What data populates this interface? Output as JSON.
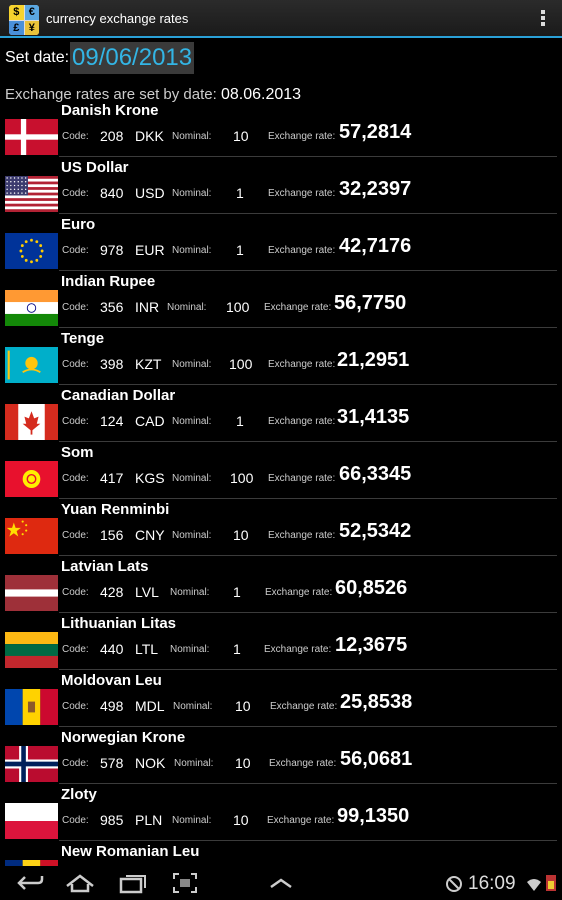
{
  "app": {
    "title": "currency exchange rates",
    "icon_letters": [
      "$",
      "€",
      "£",
      "¥"
    ]
  },
  "date_row": {
    "label": "Set date:",
    "value": "09/06/2013"
  },
  "rates_info": {
    "text": "Exchange rates are set by date:",
    "date": "08.06.2013"
  },
  "labels": {
    "code": "Code:",
    "nominal": "Nominal:",
    "exchange_rate": "Exchange rate:"
  },
  "currencies": [
    {
      "name": "Danish Krone",
      "num": "208",
      "iso": "DKK",
      "nominal": "10",
      "rate": "57,2814",
      "flag": "denmark-flag"
    },
    {
      "name": "US Dollar",
      "num": "840",
      "iso": "USD",
      "nominal": "1",
      "rate": "32,2397",
      "flag": "usa-flag"
    },
    {
      "name": "Euro",
      "num": "978",
      "iso": "EUR",
      "nominal": "1",
      "rate": "42,7176",
      "flag": "eu-flag"
    },
    {
      "name": "Indian Rupee",
      "num": "356",
      "iso": "INR",
      "nominal": "100",
      "rate": "56,7750",
      "flag": "india-flag"
    },
    {
      "name": "Tenge",
      "num": "398",
      "iso": "KZT",
      "nominal": "100",
      "rate": "21,2951",
      "flag": "kazakhstan-flag"
    },
    {
      "name": "Canadian Dollar",
      "num": "124",
      "iso": "CAD",
      "nominal": "1",
      "rate": "31,4135",
      "flag": "canada-flag"
    },
    {
      "name": "Som",
      "num": "417",
      "iso": "KGS",
      "nominal": "100",
      "rate": "66,3345",
      "flag": "kyrgyzstan-flag"
    },
    {
      "name": "Yuan Renminbi",
      "num": "156",
      "iso": "CNY",
      "nominal": "10",
      "rate": "52,5342",
      "flag": "china-flag"
    },
    {
      "name": "Latvian Lats",
      "num": "428",
      "iso": "LVL",
      "nominal": "1",
      "rate": "60,8526",
      "flag": "latvia-flag"
    },
    {
      "name": "Lithuanian Litas",
      "num": "440",
      "iso": "LTL",
      "nominal": "1",
      "rate": "12,3675",
      "flag": "lithuania-flag"
    },
    {
      "name": "Moldovan Leu",
      "num": "498",
      "iso": "MDL",
      "nominal": "10",
      "rate": "25,8538",
      "flag": "moldova-flag"
    },
    {
      "name": "Norwegian Krone",
      "num": "578",
      "iso": "NOK",
      "nominal": "10",
      "rate": "56,0681",
      "flag": "norway-flag"
    },
    {
      "name": "Zloty",
      "num": "985",
      "iso": "PLN",
      "nominal": "10",
      "rate": "99,1350",
      "flag": "poland-flag"
    },
    {
      "name": "New Romanian Leu",
      "num": "",
      "iso": "",
      "nominal": "",
      "rate": "",
      "flag": "romania-flag"
    }
  ],
  "statusbar": {
    "time": "16:09"
  },
  "colors": {
    "accent": "#33b5e5",
    "actionbar_line": "#2aa0d6"
  }
}
